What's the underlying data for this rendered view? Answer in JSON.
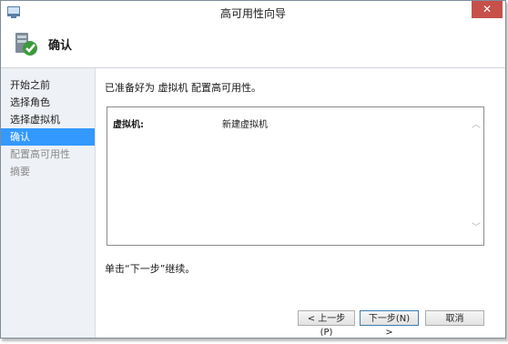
{
  "window": {
    "title": "高可用性向导",
    "close_icon": "close-icon"
  },
  "header": {
    "title": "确认",
    "icon": "wizard-server-icon"
  },
  "sidebar": {
    "items": [
      {
        "label": "开始之前",
        "state": "normal"
      },
      {
        "label": "选择角色",
        "state": "normal"
      },
      {
        "label": "选择虚拟机",
        "state": "normal"
      },
      {
        "label": "确认",
        "state": "active"
      },
      {
        "label": "配置高可用性",
        "state": "disabled"
      },
      {
        "label": "摘要",
        "state": "disabled"
      }
    ]
  },
  "main": {
    "intro": "已准备好为 虚拟机 配置高可用性。",
    "details": {
      "label": "虚拟机:",
      "value": "新建虚拟机"
    },
    "continue_text": "单击“下一步”继续。"
  },
  "buttons": {
    "prev": "< 上一步(P)",
    "next": "下一步(N) >",
    "cancel": "取消"
  },
  "colors": {
    "accent": "#3399ff",
    "close": "#c7504b"
  }
}
